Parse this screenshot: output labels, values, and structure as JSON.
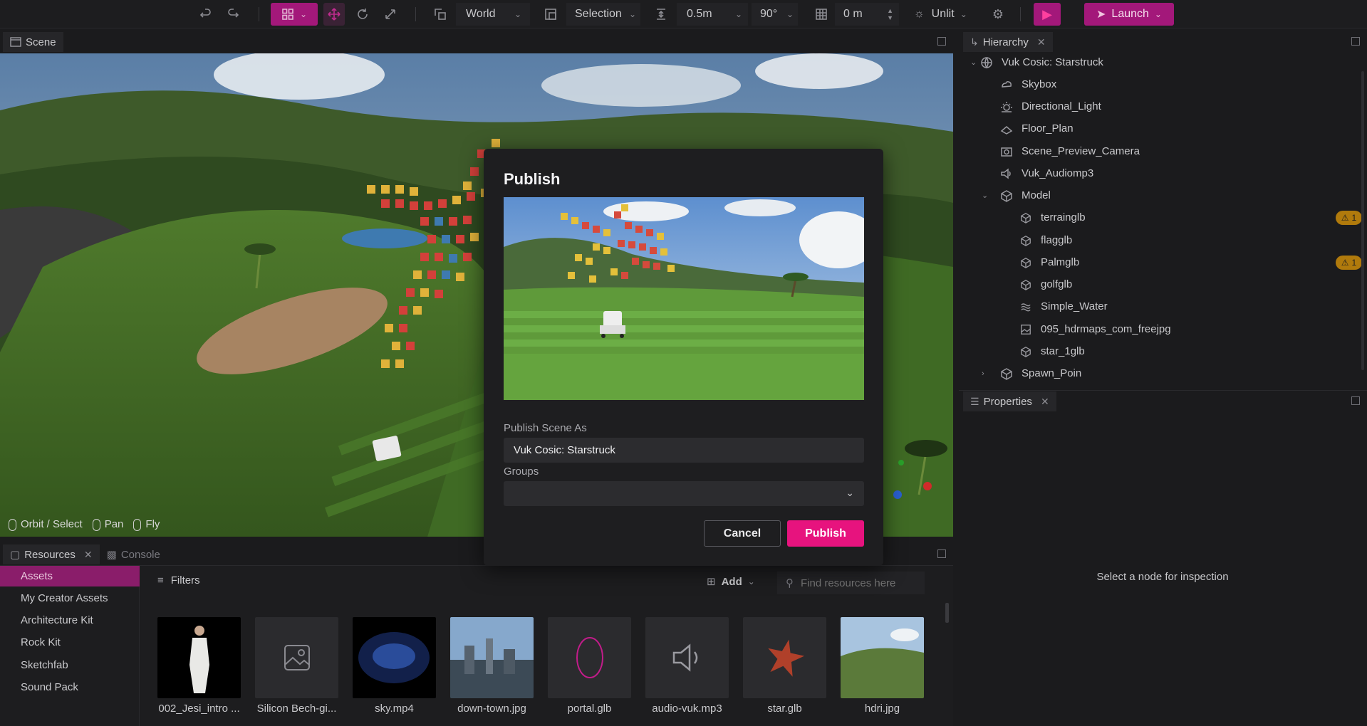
{
  "toolbar": {
    "space": "World",
    "selection_mode": "Selection",
    "snap_distance": "0.5m",
    "snap_angle": "90°",
    "grid_value": "0 m",
    "lighting": "Unlit",
    "launch_label": "Launch"
  },
  "scene_panel": {
    "title": "Scene",
    "hints": [
      "Orbit / Select",
      "Pan",
      "Fly"
    ]
  },
  "hierarchy": {
    "title": "Hierarchy",
    "root": "Vuk Cosic: Starstruck",
    "items": [
      {
        "label": "Skybox",
        "icon": "skybox-icon"
      },
      {
        "label": "Directional_Light",
        "icon": "light-icon"
      },
      {
        "label": "Floor_Plan",
        "icon": "floor-icon"
      },
      {
        "label": "Scene_Preview_Camera",
        "icon": "camera-icon"
      },
      {
        "label": "Vuk_Audiomp3",
        "icon": "speaker-icon"
      },
      {
        "label": "Model",
        "icon": "model-icon"
      },
      {
        "label": "terrainglb",
        "icon": "cube-icon",
        "warning": "1"
      },
      {
        "label": "flagglb",
        "icon": "cube-icon"
      },
      {
        "label": "Palmglb",
        "icon": "cube-icon",
        "warning": "1"
      },
      {
        "label": "golfglb",
        "icon": "cube-icon"
      },
      {
        "label": "Simple_Water",
        "icon": "water-icon"
      },
      {
        "label": "095_hdrmaps_com_freejpg",
        "icon": "image-icon"
      },
      {
        "label": "star_1glb",
        "icon": "cube-icon"
      },
      {
        "label": "Spawn_Poin",
        "icon": "model-icon"
      }
    ]
  },
  "properties": {
    "title": "Properties",
    "empty_text": "Select a node for inspection"
  },
  "resources": {
    "tab_resources": "Resources",
    "tab_console": "Console",
    "sidebar": [
      "Assets",
      "My Creator Assets",
      "Architecture Kit",
      "Rock Kit",
      "Sketchfab",
      "Sound Pack"
    ],
    "filters_label": "Filters",
    "add_label": "Add",
    "search_placeholder": "Find resources here",
    "assets": [
      "002_Jesi_intro ...",
      "Silicon Bech-gi...",
      "sky.mp4",
      "down-town.jpg",
      "portal.glb",
      "audio-vuk.mp3",
      "star.glb",
      "hdri.jpg"
    ]
  },
  "modal": {
    "title": "Publish",
    "publish_as_label": "Publish Scene As",
    "publish_as_value": "Vuk Cosic: Starstruck",
    "groups_label": "Groups",
    "groups_value": "",
    "cancel_label": "Cancel",
    "publish_label": "Publish"
  },
  "colors": {
    "accent": "#e7137e",
    "accent_dark": "#a3187a",
    "selected_bg": "#8a1d6a",
    "warning": "#b07a0c"
  }
}
